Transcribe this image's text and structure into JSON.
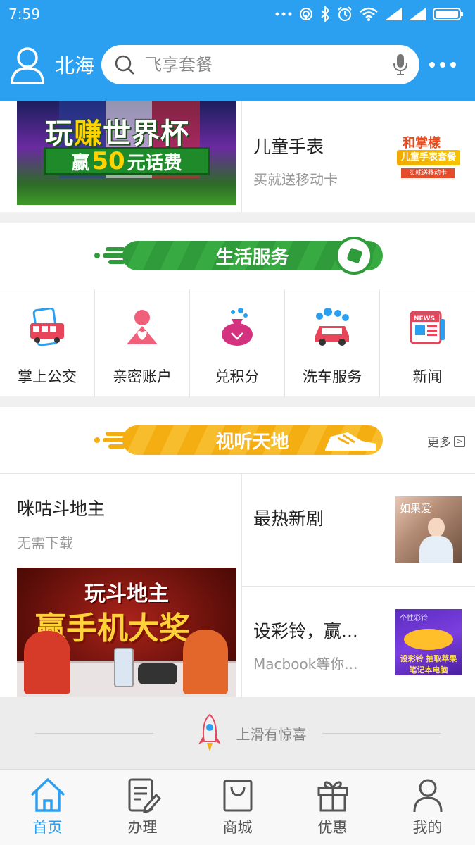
{
  "status_bar": {
    "time": "7:59",
    "icons": [
      "more-dots-icon",
      "hotspot-icon",
      "bluetooth-icon",
      "alarm-icon",
      "wifi-icon",
      "signal-icon",
      "signal-icon",
      "battery-icon"
    ]
  },
  "header": {
    "city": "北海",
    "search_placeholder": "飞享套餐",
    "accent": "#2b9ff0"
  },
  "promo": {
    "worldcup": {
      "title_pre": "玩",
      "title_hl": "赚",
      "title_post": "世界杯",
      "banner_pre": "赢",
      "banner_big": "50",
      "banner_post": "元话费"
    },
    "watch": {
      "title": "儿童手表",
      "subtitle": "买就送移动卡",
      "img_line1": "和掌樣",
      "img_line2": "儿童手表套餐",
      "img_line3": "买就送移动卡"
    }
  },
  "life_services": {
    "banner": "生活服务",
    "items": [
      {
        "label": "掌上公交",
        "icon": "bus-phone-icon"
      },
      {
        "label": "亲密账户",
        "icon": "family-account-icon"
      },
      {
        "label": "兑积分",
        "icon": "points-bag-icon"
      },
      {
        "label": "洗车服务",
        "icon": "car-wash-icon"
      },
      {
        "label": "新闻",
        "icon": "news-icon"
      }
    ]
  },
  "audio_visual": {
    "banner": "视听天地",
    "more": "更多",
    "game": {
      "title": "咪咕斗地主",
      "subtitle": "无需下载",
      "img_line1": "玩斗地主",
      "img_line2": "赢手机大奖"
    },
    "drama": {
      "title": "最热新剧",
      "img_text": "如果爱"
    },
    "ring": {
      "title": "设彩铃，赢...",
      "subtitle": "Macbook等你...",
      "img_line1": "个性彩铃",
      "img_line2": "设彩铃 抽取苹果笔记本电脑"
    }
  },
  "swipe_hint": "上滑有惊喜",
  "tabbar": [
    {
      "label": "首页",
      "icon": "home-icon",
      "active": true
    },
    {
      "label": "办理",
      "icon": "edit-doc-icon",
      "active": false
    },
    {
      "label": "商城",
      "icon": "shopping-bag-icon",
      "active": false
    },
    {
      "label": "优惠",
      "icon": "gift-icon",
      "active": false
    },
    {
      "label": "我的",
      "icon": "user-icon",
      "active": false
    }
  ]
}
